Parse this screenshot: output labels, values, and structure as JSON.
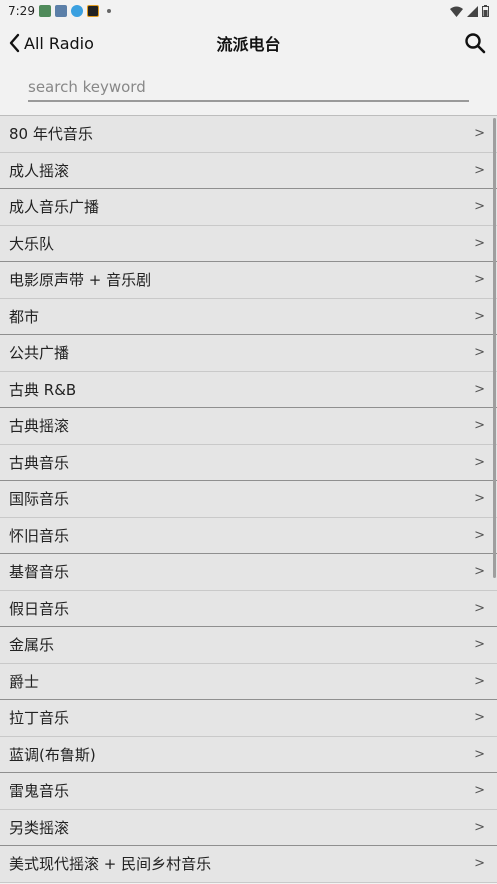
{
  "status_bar": {
    "time": "7:29"
  },
  "header": {
    "back_label": "All Radio",
    "title": "流派电台"
  },
  "search": {
    "placeholder": "search keyword",
    "value": ""
  },
  "genres": [
    "80 年代音乐",
    "成人摇滚",
    "成人音乐广播",
    "大乐队",
    "电影原声带 + 音乐剧",
    "都市",
    "公共广播",
    "古典 R&B",
    "古典摇滚",
    "古典音乐",
    "国际音乐",
    "怀旧音乐",
    "基督音乐",
    "假日音乐",
    "金属乐",
    "爵士",
    "拉丁音乐",
    "蓝调(布鲁斯)",
    "雷鬼音乐",
    "另类摇滚",
    "美式现代摇滚 + 民间乡村音乐"
  ],
  "row_chevron": ">"
}
